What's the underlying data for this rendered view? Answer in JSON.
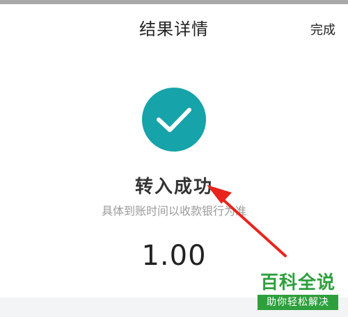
{
  "header": {
    "title": "结果详情",
    "done_label": "完成"
  },
  "result": {
    "status_icon": "check-icon",
    "title": "转入成功",
    "description": "具体到账时间以收款银行为准",
    "amount": "1.00"
  },
  "annotation": {
    "arrow_icon": "red-arrow-icon"
  },
  "watermark": {
    "main": "百科全说",
    "sub": "助你轻松解决"
  },
  "colors": {
    "accent": "#16a3a9",
    "arrow": "#e8241c",
    "watermark": "#2e9f3d"
  }
}
